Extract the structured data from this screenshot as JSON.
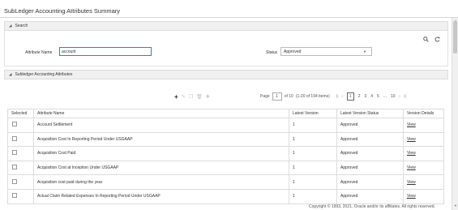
{
  "page": {
    "title": "SubLedger Accounting Attributes Summary"
  },
  "search": {
    "section_title": "Search",
    "attribute_name_label": "Attribute Name",
    "attribute_name_value": "account",
    "status_label": "Status",
    "status_value": "Approved"
  },
  "attributes": {
    "section_title": "Subledger Accounting Attributes"
  },
  "pagination": {
    "page_label": "Page",
    "current_page": "1",
    "of_text": "of 10",
    "items_text": "(1-20 of 194 items)",
    "pages": [
      "1",
      "2",
      "3",
      "4",
      "5",
      "...",
      "10"
    ]
  },
  "table": {
    "columns": [
      "Selected",
      "Attribute Name",
      "Latest Version",
      "Latest Version Status",
      "Version Details"
    ],
    "rows": [
      {
        "name": "Account Settlement",
        "version": "1",
        "status": "Approved",
        "details": "View"
      },
      {
        "name": "Acquisition Cost In Reporting Period Under USGAAP",
        "version": "1",
        "status": "Approved",
        "details": "View"
      },
      {
        "name": "Acquisition Cost Paid",
        "version": "1",
        "status": "Approved",
        "details": "View"
      },
      {
        "name": "Acquisition Cost at Inception Under USGAAP",
        "version": "1",
        "status": "Approved",
        "details": "View"
      },
      {
        "name": "Acquisition cost paid during the year",
        "version": "1",
        "status": "Approved",
        "details": "View"
      },
      {
        "name": "Actual Claim Related Expenses In Reporting Period Under USGAAP",
        "version": "1",
        "status": "Approved",
        "details": "View"
      }
    ]
  },
  "footer": {
    "copyright": "Copyright © 1993, 2021, Oracle and/or its affiliates. All rights reserved."
  }
}
